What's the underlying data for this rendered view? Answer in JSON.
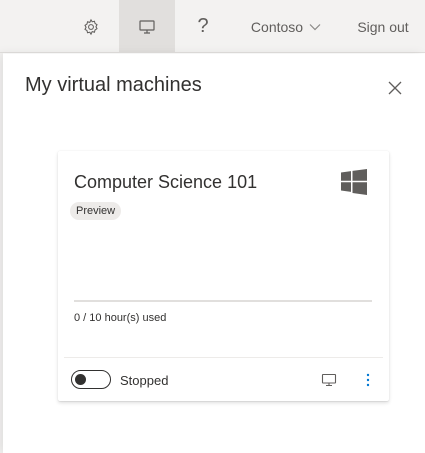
{
  "topbar": {
    "settings_icon": "gear-icon",
    "vm_icon": "monitor-icon",
    "help_label": "?",
    "tenant_label": "Contoso",
    "signout_label": "Sign out"
  },
  "panel": {
    "title": "My virtual machines",
    "close_icon": "close-icon"
  },
  "card": {
    "title": "Computer Science 101",
    "os_icon": "windows-logo-icon",
    "badge": "Preview",
    "usage_text": "0 / 10 hour(s) used",
    "usage_fraction": 0,
    "state_label": "Stopped",
    "toggle_on": false,
    "connect_icon": "monitor-icon",
    "more_icon": "more-vertical-icon"
  },
  "colors": {
    "accent": "#0078d4",
    "topbar_bg": "#f3f2f1",
    "selected_tab_bg": "#e1dfdd",
    "text": "#323130"
  }
}
